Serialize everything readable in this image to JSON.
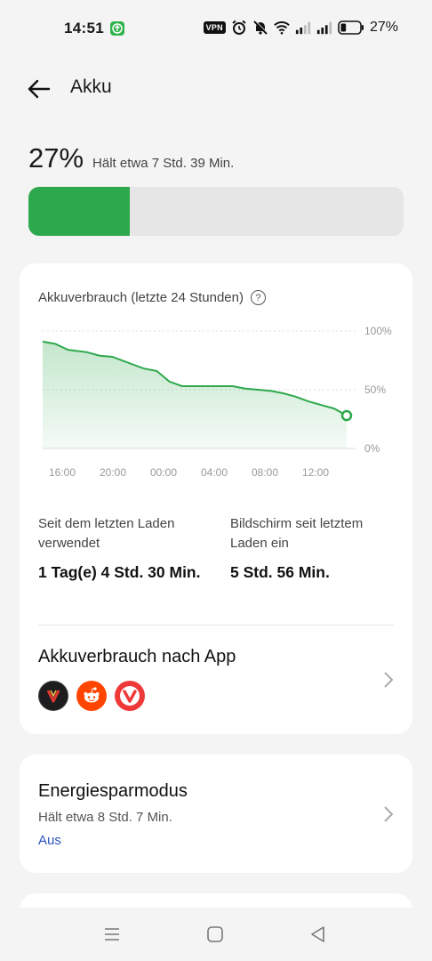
{
  "status_bar": {
    "time": "14:51",
    "vpn_label": "VPN",
    "battery_percent": "27%",
    "icons": [
      "update-icon",
      "vpn-icon",
      "alarm-icon",
      "mute-icon",
      "wifi-icon",
      "signal-icon",
      "signal-icon",
      "battery-icon"
    ]
  },
  "header": {
    "title": "Akku"
  },
  "battery": {
    "level_text": "27%",
    "level_fraction": 0.27,
    "remaining": "Hält etwa 7 Std. 39 Min.",
    "fill_color": "#2da84c"
  },
  "usage_card": {
    "chart_title": "Akkuverbrauch (letzte 24 Stunden)",
    "help_symbol": "?",
    "stat_left_label": "Seit dem letzten Laden verwendet",
    "stat_left_value": "1 Tag(e) 4 Std. 30 Min.",
    "stat_right_label": "Bildschirm seit letztem Laden ein",
    "stat_right_value": "5 Std. 56 Min.",
    "app_usage_title": "Akkuverbrauch nach App",
    "apps": [
      "vivaldi-snapshot-icon",
      "reddit-icon",
      "vivaldi-icon"
    ]
  },
  "energy_card": {
    "title": "Energiesparmodus",
    "subtitle": "Hält etwa 8 Std. 7 Min.",
    "state": "Aus",
    "state_color": "#2a52be"
  },
  "chart_data": {
    "type": "area",
    "title": "Akkuverbrauch (letzte 24 Stunden)",
    "x_tick_labels": [
      "16:00",
      "20:00",
      "00:00",
      "04:00",
      "08:00",
      "12:00"
    ],
    "y_tick_labels": [
      "100%",
      "50%",
      "0%"
    ],
    "ylim": [
      0,
      100
    ],
    "xlim_hours": [
      0,
      24
    ],
    "grid": true,
    "line_color": "#2da84c",
    "series": [
      {
        "x": [
          0,
          1,
          2,
          3.5,
          4.5,
          5.5,
          7,
          8,
          9,
          10,
          11,
          13,
          14,
          15,
          16,
          17,
          18,
          19,
          20,
          21,
          22,
          23,
          24
        ],
        "y": [
          91,
          89,
          84,
          82,
          79,
          78,
          72,
          68,
          66,
          57,
          53,
          53,
          53,
          53,
          51,
          50,
          49,
          47,
          44,
          40,
          37,
          34,
          28
        ]
      }
    ]
  },
  "navbar": {
    "icons": [
      "menu-icon",
      "home-icon",
      "back-icon"
    ]
  }
}
